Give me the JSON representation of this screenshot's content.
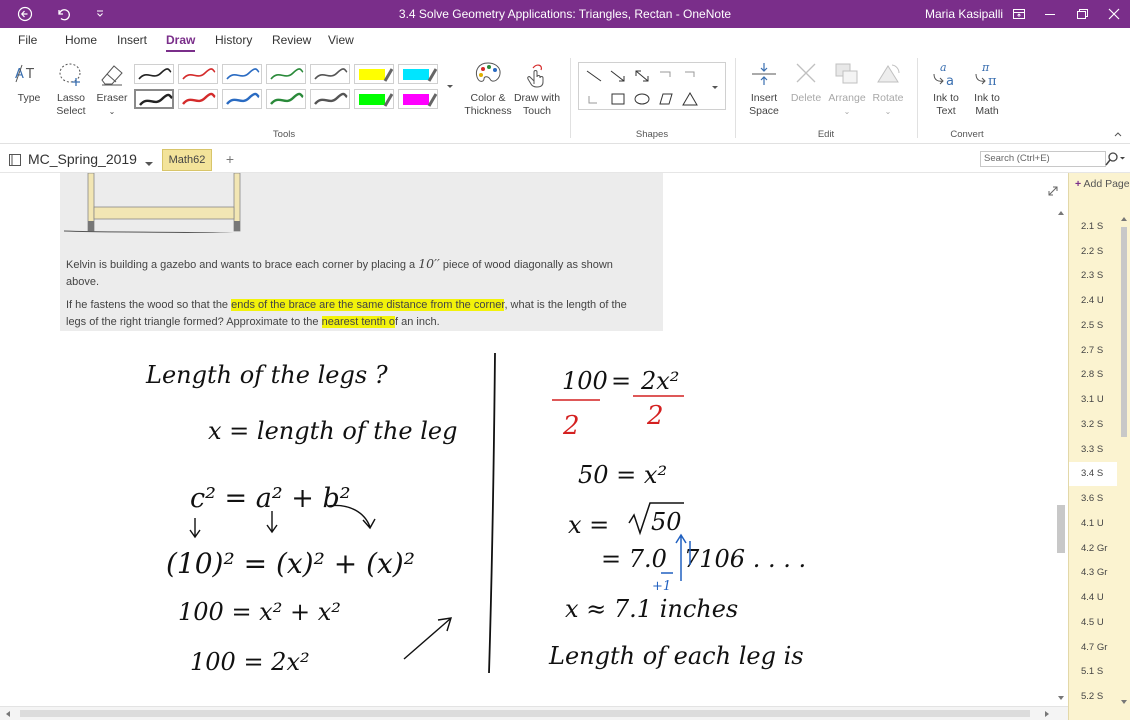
{
  "window": {
    "title": "3.4 Solve Geometry Applications: Triangles, Rectan  -  OneNote",
    "user": "Maria Kasipalli",
    "accent_color": "#7a2e8a"
  },
  "menu": {
    "tabs": [
      "File",
      "Home",
      "Insert",
      "Draw",
      "History",
      "Review",
      "View"
    ],
    "active": "Draw"
  },
  "ribbon": {
    "type_label": "Type",
    "lasso_label": "Lasso",
    "lasso_label2": "Select",
    "eraser_label": "Eraser",
    "color_label": "Color &",
    "color_label2": "Thickness",
    "touch_label": "Draw with",
    "touch_label2": "Touch",
    "tools_group": "Tools",
    "shapes_group": "Shapes",
    "insert_space_label": "Insert",
    "insert_space_label2": "Space",
    "delete_label": "Delete",
    "arrange_label": "Arrange",
    "rotate_label": "Rotate",
    "edit_group": "Edit",
    "ink_text_label": "Ink to",
    "ink_text_label2": "Text",
    "ink_math_label": "Ink to",
    "ink_math_label2": "Math",
    "convert_group": "Convert",
    "pen_colors_row1": [
      "#222222",
      "#d42b2b",
      "#2a6bc2",
      "#2a8a3a",
      "#555555"
    ],
    "pen_colors_row2": [
      "#222222",
      "#d42b2b",
      "#2a6bc2",
      "#2a8a3a",
      "#555555"
    ],
    "highlighter_colors_row1": [
      "#ffff00",
      "#00e5ff"
    ],
    "highlighter_colors_row2": [
      "#00ff00",
      "#ff00ff"
    ]
  },
  "notebook": {
    "name": "MC_Spring_2019",
    "section": "Math62",
    "add_tab": "+",
    "search_placeholder": "Search (Ctrl+E)"
  },
  "problem": {
    "line1_a": "Kelvin is building a gazebo and wants to brace each corner by placing a ",
    "line1_math": "10′′",
    "line1_b": " piece of wood diagonally as shown",
    "line2": "above.",
    "line3_a": "If he fastens the wood so that the ",
    "line3_highlight": "ends of the brace are the same distance from the corner",
    "line3_b": ", what is the length of the",
    "line4_a": "legs of the right triangle formed? Approximate to the ",
    "line4_highlight": "nearest tenth o",
    "line4_b": "f an inch.",
    "highlight_color": "#f2f20a"
  },
  "handwriting": {
    "left": {
      "heading": "Length of the legs ?",
      "define": "x = length of the leg",
      "pythagoras": "c² = a² + b²",
      "substituted": "(10)² = (x)² + (x)²",
      "step1": "100 = x² + x²",
      "step2": "100 = 2x²"
    },
    "right": {
      "div_top_left": "100",
      "div_eq": "=",
      "div_top_right": "2x²",
      "div_bottom_left": "2",
      "div_bottom_right": "2",
      "fifty": "50 = x²",
      "sqrt_lhs": "x =",
      "sqrt_rad": "50",
      "approx_a": "= 7.0",
      "approx_b": "7106 . . . .",
      "plus_one": "+1",
      "result": "x ≈ 7.1 inches",
      "sentence": "Length of each leg is"
    },
    "ink_black": "#111111",
    "ink_red": "#d42020",
    "ink_blue": "#2060c0"
  },
  "pages": {
    "add_label": "Add Page",
    "items": [
      "2.1 S",
      "2.2 S",
      "2.3 S",
      "2.4 U",
      "2.5 S",
      "2.7 S",
      "2.8 S",
      "3.1 U",
      "3.2 S",
      "3.3 S",
      "3.4 S",
      "3.6 S",
      "4.1 U",
      "4.2 Gr",
      "4.3 Gr",
      "4.4 U",
      "4.5 U",
      "4.7 Gr",
      "5.1 S",
      "5.2 S"
    ],
    "active": "3.4 S"
  }
}
